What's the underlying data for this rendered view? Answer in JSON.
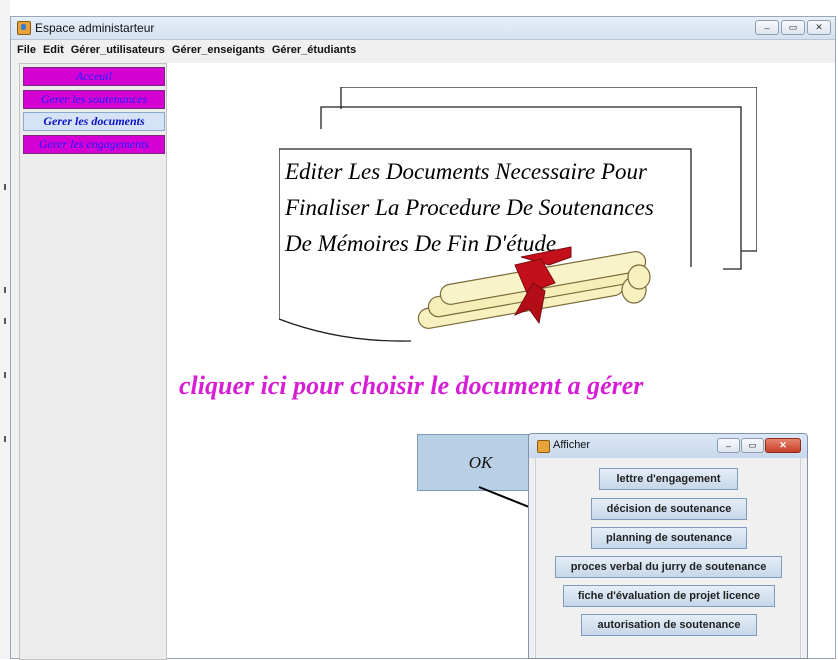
{
  "window": {
    "title": "Espace administarteur",
    "controls": {
      "minimize": "–",
      "maximize": "▭",
      "close": "✕"
    }
  },
  "menubar": {
    "items": [
      "File",
      "Edit",
      "Gérer_utilisateurs",
      "Gérer_enseigants",
      "Gérer_étudiants"
    ]
  },
  "sidebar": {
    "tabs": [
      {
        "label": "Acceuil"
      },
      {
        "label": "Gerer les soutenances"
      },
      {
        "label": "Gerer les documents"
      },
      {
        "label": "Gerer les engagements"
      }
    ]
  },
  "banner": {
    "lines": [
      "Editer Les Documents Necessaire Pour",
      "Finaliser La Procedure De Soutenances",
      "De Mémoires De Fin D'étude"
    ]
  },
  "main": {
    "prompt": "cliquer ici pour choisir le document a gérer",
    "ok_label": "OK"
  },
  "dialog": {
    "title": "Afficher",
    "controls": {
      "minimize": "–",
      "maximize": "▭",
      "close": "✕"
    },
    "buttons": [
      "lettre d'engagement",
      "décision de soutenance",
      "planning de soutenance",
      "proces verbal du jurry de soutenance",
      "fiche d'évaluation de projet licence",
      "autorisation de soutenance"
    ]
  },
  "colors": {
    "accent_magenta": "#d61ed6",
    "tab_pink": "#d400d4",
    "tab_blue": "#d4e4f6",
    "ok_button": "#b8cfe6"
  }
}
